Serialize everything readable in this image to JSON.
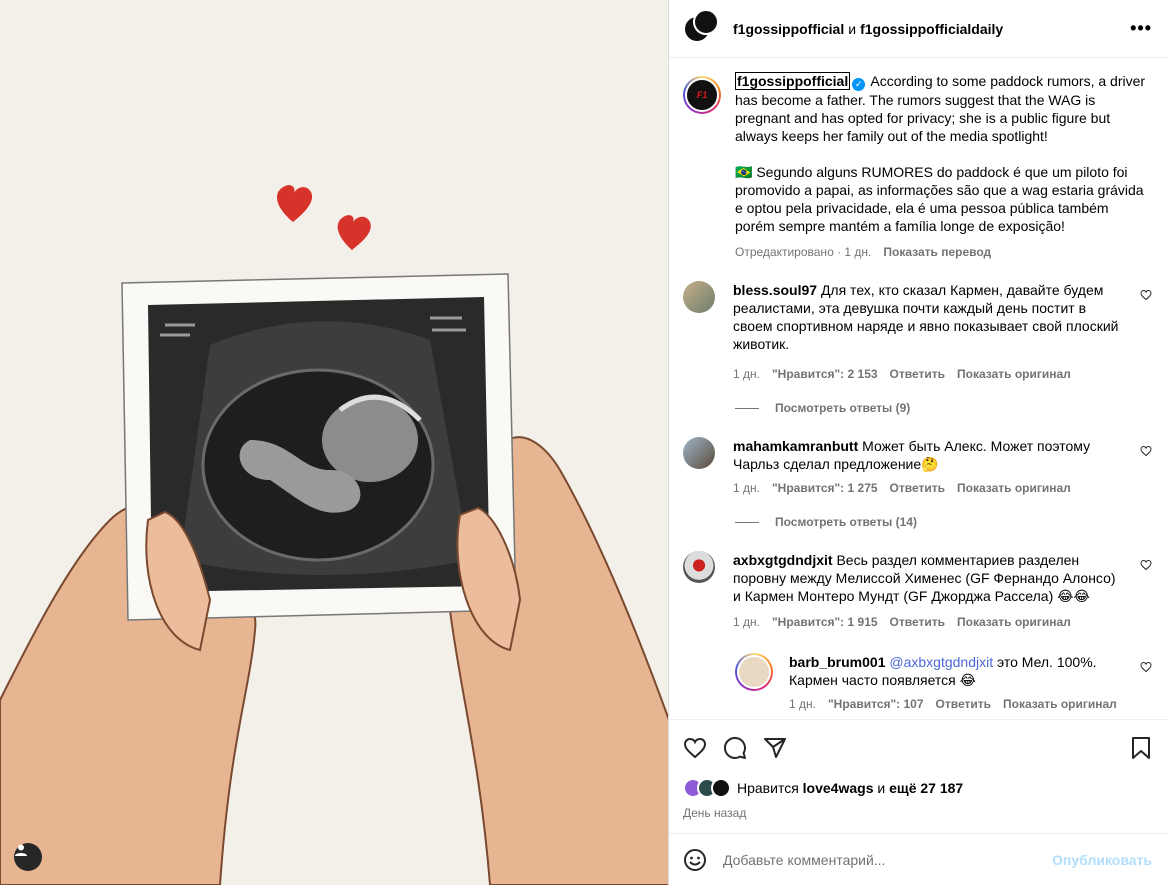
{
  "header": {
    "user1": "f1gossippofficial",
    "conj": "и",
    "user2": "f1gossippofficialdaily",
    "more": "•••"
  },
  "caption": {
    "username": "f1gossippofficial",
    "text_en": "According to some paddock rumors, a driver has become a father. The rumors suggest that the WAG is pregnant and has opted for privacy; she is a public figure but always keeps her family out of the media spotlight!",
    "text_pt": "🇧🇷 Segundo alguns RUMORES do paddock é que um piloto foi promovido a papai, as informações são que a wag estaria grávida e optou pela privacidade, ela é uma pessoa pública também porém sempre mantém a família longe de exposição!",
    "edited": "Отредактировано · 1 дн.",
    "translate": "Показать перевод"
  },
  "comments": [
    {
      "username": "bless.soul97",
      "text": "Для тех, кто сказал Кармен, давайте будем реалистами, эта девушка почти каждый день постит в своем спортивном наряде и явно показывает свой плоский животик.",
      "time": "1 дн.",
      "likes": "\"Нравится\": 2 153",
      "reply": "Ответить",
      "original": "Показать оригинал",
      "view_replies": "Посмотреть ответы (9)"
    },
    {
      "username": "mahamkamranbutt",
      "text": "Может быть Алекс. Может поэтому Чарльз сделал предложение🤔",
      "time": "1 дн.",
      "likes": "\"Нравится\": 1 275",
      "reply": "Ответить",
      "original": "Показать оригинал",
      "view_replies": "Посмотреть ответы (14)"
    },
    {
      "username": "axbxgtgdndjxit",
      "text": "Весь раздел комментариев разделен поровну между Мелиссой Хименес (GF Фернандо Алонсо) и Кармен Монтеро Мундт (GF Джорджа Рассела) 😂😂",
      "time": "1 дн.",
      "likes": "\"Нравится\": 1 915",
      "reply": "Ответить",
      "original": "Показать оригинал"
    }
  ],
  "reply": {
    "username": "barb_brum001",
    "mention": "@axbxgtgdndjxit",
    "text": " это Мел. 100%. Кармен часто появляется 😂",
    "time": "1 дн.",
    "likes": "\"Нравится\": 107",
    "reply": "Ответить",
    "original": "Показать оригинал"
  },
  "likes": {
    "prefix": "Нравится",
    "user": "love4wags",
    "and": "и",
    "others": "ещё 27 187",
    "date": "День назад"
  },
  "composer": {
    "placeholder": "Добавьте комментарий...",
    "post": "Опубликовать"
  },
  "colors": {
    "link": "#00376b",
    "mention": "#4c68d7",
    "verified": "#0095f6",
    "post_disabled": "#b2dffc"
  }
}
